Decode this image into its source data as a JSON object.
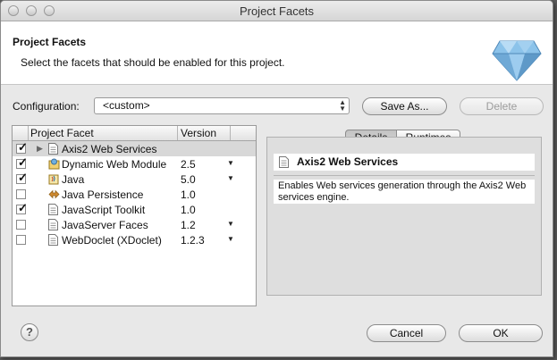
{
  "window": {
    "title": "Project Facets"
  },
  "banner": {
    "title": "Project Facets",
    "description": "Select the facets that should be enabled for this project."
  },
  "configuration": {
    "label": "Configuration:",
    "value": "<custom>",
    "save_as_label": "Save As...",
    "delete_label": "Delete"
  },
  "table": {
    "headers": {
      "facet": "Project Facet",
      "version": "Version"
    },
    "rows": [
      {
        "name": "Axis2 Web Services",
        "version": "",
        "checked": true,
        "selected": true,
        "expandable": true,
        "icon": "facet-page-icon",
        "has_dropdown": false
      },
      {
        "name": "Dynamic Web Module",
        "version": "2.5",
        "checked": true,
        "selected": false,
        "expandable": false,
        "icon": "web-module-icon",
        "has_dropdown": true
      },
      {
        "name": "Java",
        "version": "5.0",
        "checked": true,
        "selected": false,
        "expandable": false,
        "icon": "java-icon",
        "has_dropdown": true
      },
      {
        "name": "Java Persistence",
        "version": "1.0",
        "checked": false,
        "selected": false,
        "expandable": false,
        "icon": "persistence-icon",
        "has_dropdown": false
      },
      {
        "name": "JavaScript Toolkit",
        "version": "1.0",
        "checked": true,
        "selected": false,
        "expandable": false,
        "icon": "facet-page-icon",
        "has_dropdown": false
      },
      {
        "name": "JavaServer Faces",
        "version": "1.2",
        "checked": false,
        "selected": false,
        "expandable": false,
        "icon": "facet-page-icon",
        "has_dropdown": true
      },
      {
        "name": "WebDoclet (XDoclet)",
        "version": "1.2.3",
        "checked": false,
        "selected": false,
        "expandable": false,
        "icon": "facet-page-icon",
        "has_dropdown": true
      }
    ]
  },
  "details": {
    "tabs": [
      "Details",
      "Runtimes"
    ],
    "active_tab": "Details",
    "title": "Axis2 Web Services",
    "description": "Enables Web services generation through the Axis2 Web services engine."
  },
  "footer": {
    "help_label": "?",
    "cancel_label": "Cancel",
    "ok_label": "OK"
  },
  "colors": {
    "window_bg": "#e8e8e8",
    "selected_row": "#d8d8d8",
    "panel_bg": "#dedede",
    "gem": "#7fb6e0"
  }
}
